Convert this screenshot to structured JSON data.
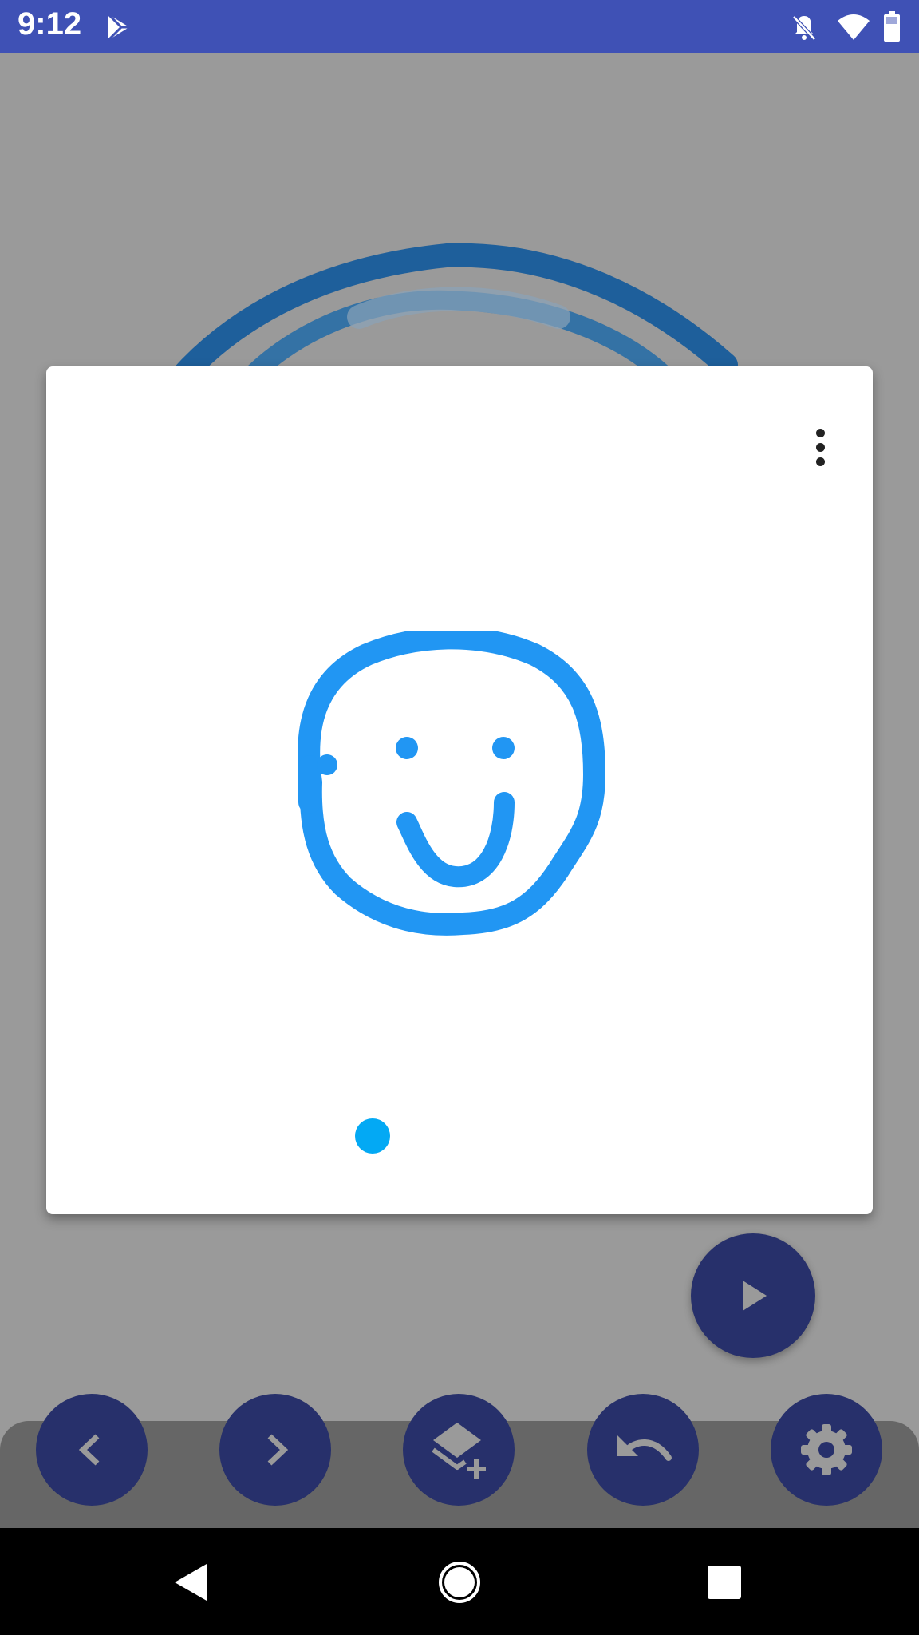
{
  "status_bar": {
    "time": "9:12",
    "background_color": "#3f51b5",
    "icons": [
      "play-store-icon",
      "notifications-off-icon",
      "wifi-icon",
      "battery-icon"
    ]
  },
  "dialog": {
    "menu_icon": "more-vert-icon",
    "drawing": "smiley-face-sketch",
    "stroke_color": "#2196f3",
    "selected_color": "#03a9f4"
  },
  "fab": {
    "icon": "play-icon",
    "color": "#27306b"
  },
  "toolbar": {
    "buttons": [
      {
        "icon": "chevron-left-icon"
      },
      {
        "icon": "chevron-right-icon"
      },
      {
        "icon": "add-layer-icon"
      },
      {
        "icon": "undo-icon"
      },
      {
        "icon": "settings-icon"
      }
    ]
  },
  "nav_bar": {
    "icons": [
      "back-icon",
      "home-icon",
      "recents-icon"
    ]
  }
}
